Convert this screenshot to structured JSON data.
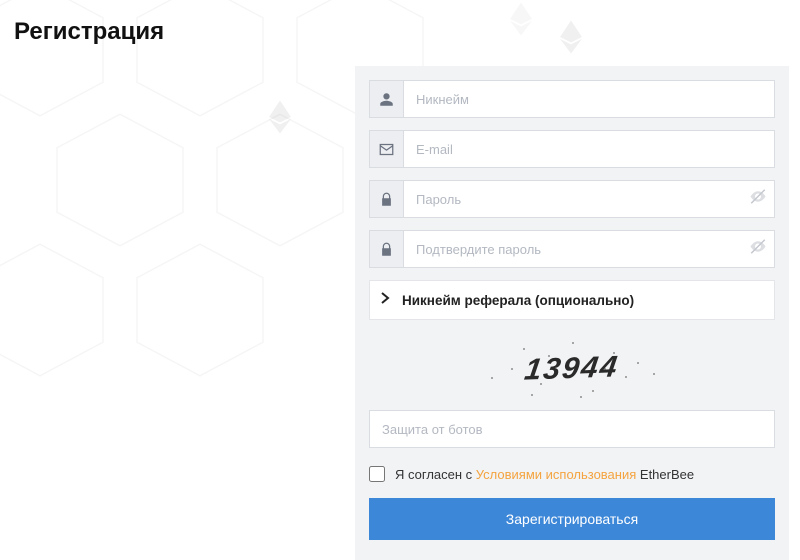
{
  "title": "Регистрация",
  "form": {
    "nickname": {
      "placeholder": "Никнейм",
      "value": ""
    },
    "email": {
      "placeholder": "E-mail",
      "value": ""
    },
    "password": {
      "placeholder": "Пароль",
      "value": ""
    },
    "password_confirm": {
      "placeholder": "Подтвердите пароль",
      "value": ""
    },
    "referral_toggle_label": "Никнейм реферала (опционально)",
    "captcha": {
      "image_text": "13944",
      "input_placeholder": "Защита от ботов",
      "input_value": ""
    },
    "agree": {
      "checked": false,
      "prefix": "Я согласен с ",
      "link_text": "Условиями использования",
      "suffix": " EtherBee"
    },
    "submit_label": "Зарегистрироваться"
  },
  "icons": {
    "user": "user-icon",
    "mail": "mail-icon",
    "lock": "lock-icon",
    "eye_off": "eye-off-icon",
    "chevron": "chevron-right-icon"
  },
  "colors": {
    "accent_link": "#f4a33f",
    "primary_button": "#3d87d8",
    "panel_bg": "#f2f3f5"
  }
}
